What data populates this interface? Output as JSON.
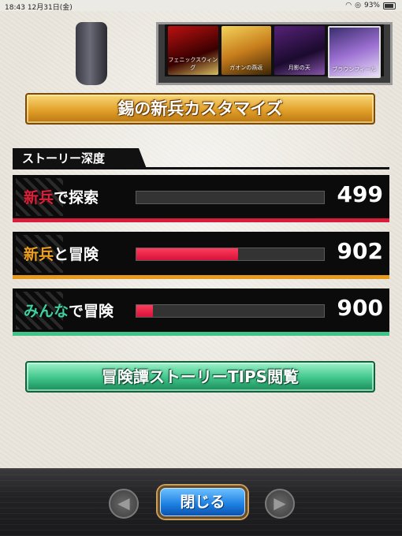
{
  "status_bar": {
    "time": "18:43",
    "date": "12月31日(金)",
    "battery": "93%"
  },
  "cards": [
    {
      "label": "フェニックスウィング"
    },
    {
      "label": "ガオンの燕返"
    },
    {
      "label": "月影の天"
    },
    {
      "label": "ブラウンフィール"
    }
  ],
  "customize_button": {
    "label": "錫の新兵カスタマイズ"
  },
  "story_depth": {
    "title": "ストーリー深度",
    "rows": [
      {
        "highlight": "新兵",
        "suffix": "で探索",
        "value": "499",
        "progress": 0.0,
        "highlight_color": "#e0203a",
        "underline_color": "#d81c3c"
      },
      {
        "highlight": "新兵",
        "suffix": "と冒険",
        "value": "902",
        "progress": 0.54,
        "highlight_color": "#f0a020",
        "underline_color": "#e89a1a"
      },
      {
        "highlight": "みんな",
        "suffix": "で冒険",
        "value": "900",
        "progress": 0.09,
        "highlight_color": "#3fd0a0",
        "underline_color": "#3fc48a"
      }
    ]
  },
  "tips_button": {
    "label": "冒険譚ストーリーTIPS閲覧"
  },
  "bottom_bar": {
    "prev_icon": "arrow-left-icon",
    "next_icon": "arrow-right-icon",
    "close_label": "閉じる"
  }
}
